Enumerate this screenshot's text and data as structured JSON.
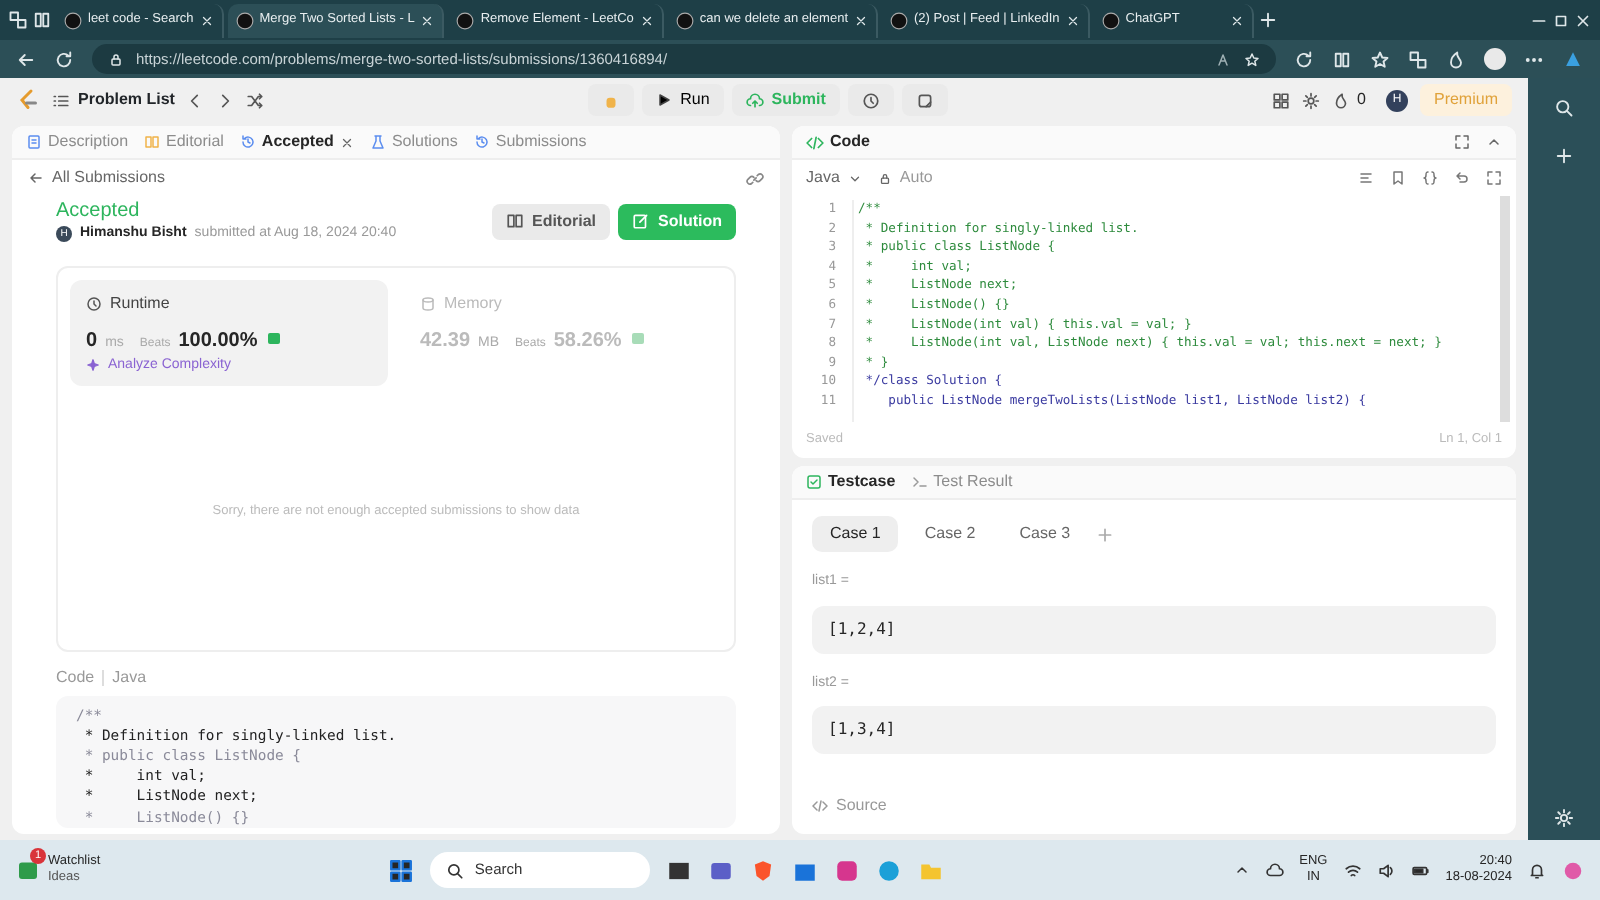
{
  "browser": {
    "tabs": [
      {
        "title": "leet code - Search",
        "selected": false
      },
      {
        "title": "Merge Two Sorted Lists - L",
        "selected": true
      },
      {
        "title": "Remove Element - LeetCo",
        "selected": false
      },
      {
        "title": "can we delete an element",
        "selected": false
      },
      {
        "title": "(2) Post | Feed | LinkedIn",
        "selected": false
      },
      {
        "title": "ChatGPT",
        "selected": false
      }
    ],
    "url": "https://leetcode.com/problems/merge-two-sorted-lists/submissions/1360416894/"
  },
  "toolbar": {
    "problem_list": "Problem List",
    "run": "Run",
    "submit": "Submit",
    "streak": "0",
    "avatar": "H",
    "premium": "Premium"
  },
  "left_panel": {
    "tabs": [
      {
        "label": "Description",
        "selected": false,
        "closable": false
      },
      {
        "label": "Editorial",
        "selected": false,
        "closable": false
      },
      {
        "label": "Accepted",
        "selected": true,
        "closable": true
      },
      {
        "label": "Solutions",
        "selected": false,
        "closable": false
      },
      {
        "label": "Submissions",
        "selected": false,
        "closable": false
      }
    ],
    "back_link": "All Submissions",
    "status": "Accepted",
    "author": "Himanshu Bisht",
    "author_initial": "H",
    "submitted": "submitted at Aug 18, 2024 20:40",
    "editorial_button": "Editorial",
    "solution_button": "Solution",
    "runtime": {
      "label": "Runtime",
      "value": "0",
      "unit": "ms",
      "beats_label": "Beats",
      "beats": "100.00%",
      "analyze": "Analyze Complexity"
    },
    "memory": {
      "label": "Memory",
      "value": "42.39",
      "unit": "MB",
      "beats_label": "Beats",
      "beats": "58.26%"
    },
    "empty_message": "Sorry, there are not enough accepted submissions to show data",
    "code_label": "Code",
    "code_language": "Java",
    "code_lines": [
      {
        "text": "/**",
        "kind": "dim"
      },
      {
        "text": " * Definition for singly-linked list.",
        "kind": "plain"
      },
      {
        "text": " * public class ListNode {",
        "kind": "dim"
      },
      {
        "text": " *     int val;",
        "kind": "plain"
      },
      {
        "text": " *     ListNode next;",
        "kind": "plain"
      },
      {
        "text": " *     ListNode() {}",
        "kind": "dim"
      }
    ]
  },
  "editor": {
    "title": "Code",
    "language": "Java",
    "mode": "Auto",
    "lines": [
      {
        "num": "1",
        "text": "/**",
        "kind": "comment"
      },
      {
        "num": "2",
        "text": " * Definition for singly-linked list.",
        "kind": "comment"
      },
      {
        "num": "3",
        "text": " * public class ListNode {",
        "kind": "comment"
      },
      {
        "num": "4",
        "text": " *     int val;",
        "kind": "comment"
      },
      {
        "num": "5",
        "text": " *     ListNode next;",
        "kind": "comment"
      },
      {
        "num": "6",
        "text": " *     ListNode() {}",
        "kind": "comment"
      },
      {
        "num": "7",
        "text": " *     ListNode(int val) { this.val = val; }",
        "kind": "comment"
      },
      {
        "num": "8",
        "text": " *     ListNode(int val, ListNode next) { this.val = val; this.next = next; }",
        "kind": "comment"
      },
      {
        "num": "9",
        "text": " * }",
        "kind": "comment"
      },
      {
        "num": "10",
        "text": " */class Solution {",
        "kind": "code"
      },
      {
        "num": "11",
        "text": "    public ListNode mergeTwoLists(ListNode list1, ListNode list2) {",
        "kind": "code"
      }
    ],
    "status": "Saved",
    "cursor": "Ln 1, Col 1"
  },
  "testcase": {
    "tabs": [
      {
        "label": "Testcase",
        "selected": true
      },
      {
        "label": "Test Result",
        "selected": false
      }
    ],
    "cases": [
      {
        "label": "Case 1",
        "selected": true
      },
      {
        "label": "Case 2",
        "selected": false
      },
      {
        "label": "Case 3",
        "selected": false
      }
    ],
    "inputs": [
      {
        "label": "list1 =",
        "value": "[1,2,4]"
      },
      {
        "label": "list2 =",
        "value": "[1,3,4]"
      }
    ],
    "source": "Source"
  },
  "taskbar": {
    "widget_title": "Watchlist",
    "widget_subtitle": "Ideas",
    "widget_badge": "1",
    "search": "Search",
    "lang": "ENG",
    "region": "IN",
    "time": "20:40",
    "date": "18-08-2024"
  }
}
